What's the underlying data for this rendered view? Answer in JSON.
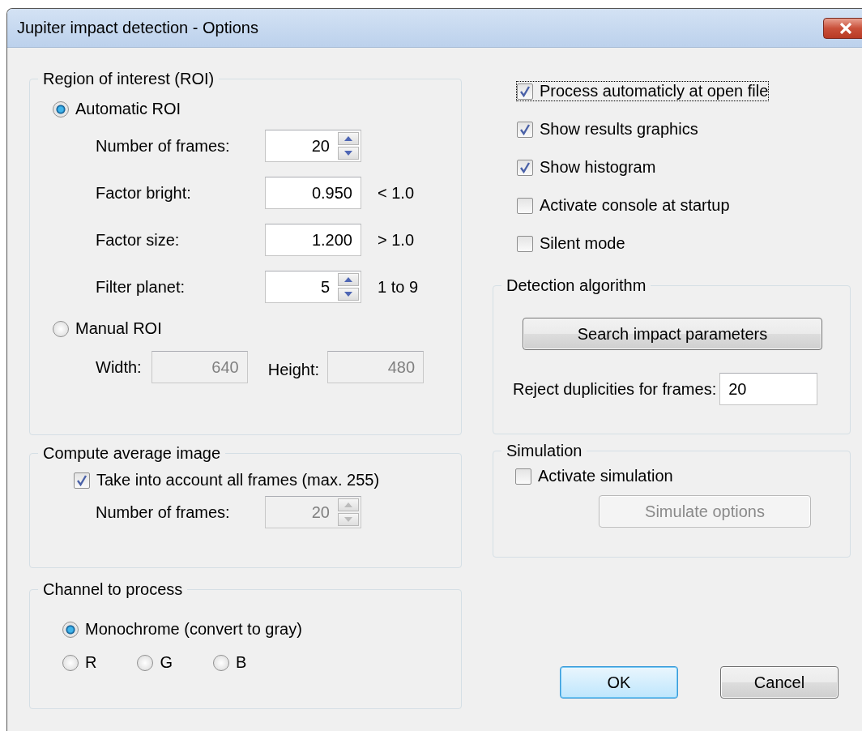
{
  "window": {
    "title": "Jupiter impact detection - Options"
  },
  "roi": {
    "title": "Region of interest (ROI)",
    "automatic": {
      "label": "Automatic ROI",
      "selected": true
    },
    "params": [
      {
        "label": "Number of frames:",
        "value": "20",
        "kind": "spin"
      },
      {
        "label": "Factor bright:",
        "value": "0.950",
        "kind": "text",
        "hint": "< 1.0"
      },
      {
        "label": "Factor size:",
        "value": "1.200",
        "kind": "text",
        "hint": "> 1.0"
      },
      {
        "label": "Filter planet:",
        "value": "5",
        "kind": "spin",
        "hint": "1 to 9"
      }
    ],
    "manual": {
      "label": "Manual ROI",
      "selected": false
    },
    "size": [
      {
        "label": "Width:",
        "value": "640",
        "disabled": true
      },
      {
        "label": "Height:",
        "value": "480",
        "disabled": true
      }
    ]
  },
  "average": {
    "title": "Compute average image",
    "all_frames": {
      "label": "Take into account all frames (max. 255)",
      "checked": true
    },
    "frames": {
      "label": "Number of frames:",
      "value": "20",
      "disabled": true
    }
  },
  "channel": {
    "title": "Channel to process",
    "options": [
      {
        "label": "Monochrome (convert to gray)",
        "selected": true,
        "kind": "line"
      },
      {
        "label": "R",
        "selected": false,
        "kind": "inline"
      },
      {
        "label": "G",
        "selected": false,
        "kind": "inline"
      },
      {
        "label": "B",
        "selected": false,
        "kind": "inline"
      }
    ]
  },
  "options": [
    {
      "label": "Process automaticly at open file",
      "checked": true,
      "focused": true
    },
    {
      "label": "Show results graphics",
      "checked": true,
      "focused": false
    },
    {
      "label": "Show histogram",
      "checked": true,
      "focused": false
    },
    {
      "label": "Activate console at startup",
      "checked": false,
      "focused": false
    },
    {
      "label": "Silent mode",
      "checked": false,
      "focused": false
    }
  ],
  "detection": {
    "title": "Detection algorithm",
    "button": "Search impact parameters",
    "reject": {
      "label": "Reject duplicities for frames:",
      "value": "20"
    }
  },
  "simulation": {
    "title": "Simulation",
    "activate": {
      "label": "Activate simulation",
      "checked": false
    },
    "button": {
      "label": "Simulate options",
      "disabled": true
    }
  },
  "buttons": [
    {
      "label": "OK",
      "default": true
    },
    {
      "label": "Cancel",
      "default": false
    }
  ]
}
